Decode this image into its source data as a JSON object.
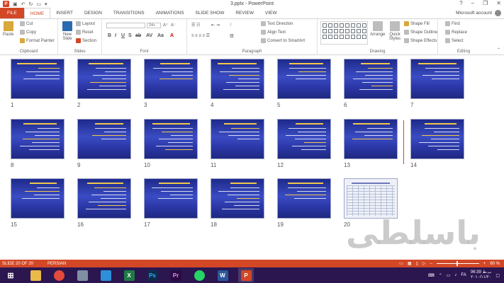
{
  "window": {
    "title": "3.pptx - PowerPoint",
    "controls": [
      "?",
      "–",
      "❐",
      "✕"
    ]
  },
  "tabs": [
    {
      "label": "FILE"
    },
    {
      "label": "HOME"
    },
    {
      "label": "INSERT"
    },
    {
      "label": "DESIGN"
    },
    {
      "label": "TRANSITIONS"
    },
    {
      "label": "ANIMATIONS"
    },
    {
      "label": "SLIDE SHOW"
    },
    {
      "label": "REVIEW"
    },
    {
      "label": "VIEW"
    }
  ],
  "account": {
    "label": "Microsoft account"
  },
  "ribbon": {
    "clipboard": {
      "paste": "Paste",
      "cut": "Cut",
      "copy": "Copy",
      "format_painter": "Format Painter",
      "label": "Clipboard"
    },
    "slides": {
      "new_slide": "New Slide",
      "layout": "Layout",
      "reset": "Reset",
      "section": "Section",
      "label": "Slides"
    },
    "font": {
      "size": "24+",
      "label": "Font"
    },
    "paragraph": {
      "text_direction": "Text Direction",
      "align_text": "Align Text",
      "smartart": "Convert to SmartArt",
      "label": "Paragraph"
    },
    "drawing": {
      "arrange": "Arrange",
      "quick_styles": "Quick Styles",
      "shape_fill": "Shape Fill",
      "shape_outline": "Shape Outline",
      "shape_effects": "Shape Effects",
      "label": "Drawing"
    },
    "editing": {
      "find": "Find",
      "replace": "Replace",
      "select": "Select",
      "label": "Editing"
    }
  },
  "slides": [
    {
      "num": "1"
    },
    {
      "num": "2"
    },
    {
      "num": "3"
    },
    {
      "num": "4"
    },
    {
      "num": "5"
    },
    {
      "num": "6"
    },
    {
      "num": "7"
    },
    {
      "num": "8"
    },
    {
      "num": "9"
    },
    {
      "num": "10"
    },
    {
      "num": "11"
    },
    {
      "num": "12"
    },
    {
      "num": "13"
    },
    {
      "num": "14"
    },
    {
      "num": "15"
    },
    {
      "num": "16"
    },
    {
      "num": "17"
    },
    {
      "num": "18"
    },
    {
      "num": "19"
    },
    {
      "num": "20"
    }
  ],
  "watermark": "باسلطی",
  "status": {
    "slide": "SLIDE 20 OF 20",
    "language": "PERSIAN",
    "zoom": "60 %"
  },
  "taskbar": {
    "apps": [
      "Start",
      "Explorer",
      "Chrome",
      "Devices",
      "Store",
      "Excel",
      "Photoshop",
      "Premiere",
      "WhatsApp",
      "Word",
      "PowerPoint"
    ],
    "lang": "FA",
    "time": "06:39 ب.ظ",
    "date": "۲۰۱۰/۱۱/۲۰"
  },
  "colors": {
    "accent": "#d24726",
    "taskbar": "#2b1650"
  }
}
